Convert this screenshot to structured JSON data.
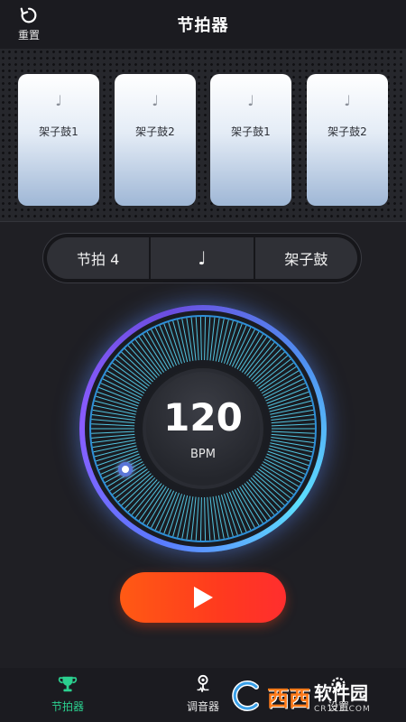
{
  "header": {
    "title": "节拍器",
    "reset_label": "重置",
    "reset_icon": "refresh-icon"
  },
  "beats": [
    {
      "note": "♩",
      "label": "架子鼓1"
    },
    {
      "note": "♩",
      "label": "架子鼓2"
    },
    {
      "note": "♩",
      "label": "架子鼓1"
    },
    {
      "note": "♩",
      "label": "架子鼓2"
    }
  ],
  "settings": {
    "time_signature": "节拍 4",
    "note_value": "♩",
    "sound": "架子鼓"
  },
  "tempo": {
    "value": "120",
    "unit": "BPM"
  },
  "tabs": [
    {
      "label": "节拍器",
      "icon": "trophy-icon",
      "active": true
    },
    {
      "label": "调音器",
      "icon": "tuner-pin-icon",
      "active": false
    },
    {
      "label": "设置",
      "icon": "gear-icon",
      "active": false
    }
  ],
  "watermark": {
    "brand": "西西",
    "text": "软件园",
    "domain": "CR173.COM"
  },
  "colors": {
    "accent_green": "#2bd08f",
    "play_orange": "#ff4a1a",
    "dial_cyan": "#5de0ff",
    "dial_purple": "#8a5cff"
  }
}
